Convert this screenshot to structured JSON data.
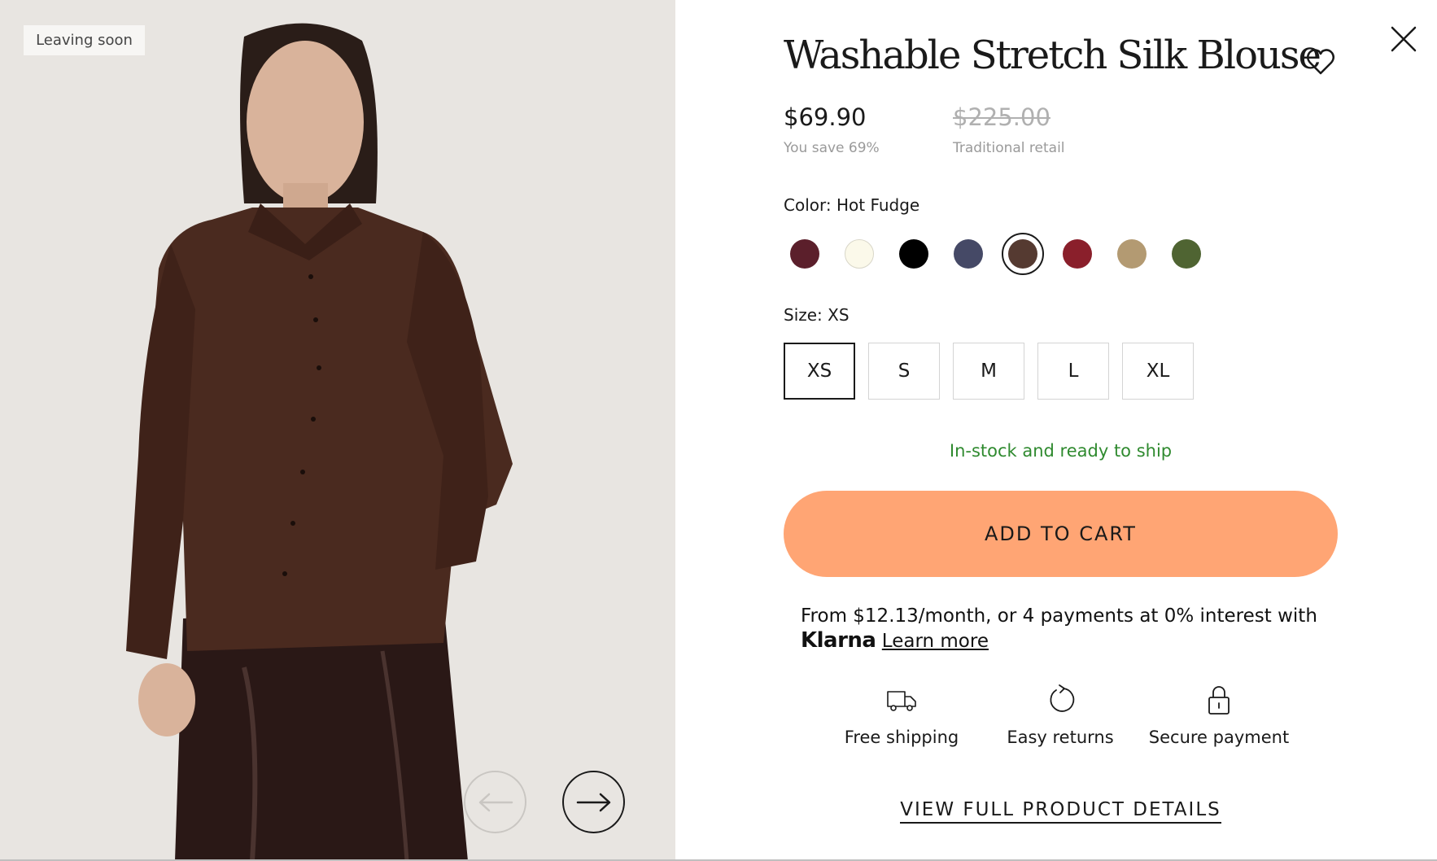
{
  "gallery": {
    "badge": "Leaving soon",
    "prev_icon": "arrow-left-icon",
    "next_icon": "arrow-right-icon"
  },
  "product": {
    "title": "Washable Stretch Silk Blouse",
    "price": "$69.90",
    "savings": "You save 69%",
    "original_price": "$225.00",
    "original_label": "Traditional retail",
    "color_label": "Color:",
    "color_value": "Hot Fudge",
    "colors": [
      {
        "hex": "#5b1f2b"
      },
      {
        "hex": "#fbf9ea"
      },
      {
        "hex": "#000000"
      },
      {
        "hex": "#454966"
      },
      {
        "hex": "#553a31",
        "selected": true
      },
      {
        "hex": "#8a1f2b"
      },
      {
        "hex": "#b39a72"
      },
      {
        "hex": "#4f6432"
      }
    ],
    "size_label": "Size:",
    "size_value": "XS",
    "sizes": [
      "XS",
      "S",
      "M",
      "L",
      "XL"
    ],
    "selected_size": "XS",
    "stock_status": "In-stock and ready to ship",
    "add_to_cart": "ADD TO CART"
  },
  "klarna": {
    "text": "From $12.13/month, or 4 payments at 0% interest with",
    "logo": "Klarna",
    "learn_more": "Learn more"
  },
  "features": [
    {
      "icon": "truck-icon",
      "label": "Free shipping"
    },
    {
      "icon": "return-arrow-icon",
      "label": "Easy returns"
    },
    {
      "icon": "lock-icon",
      "label": "Secure payment"
    }
  ],
  "view_details": "VIEW FULL PRODUCT DETAILS",
  "icons": {
    "close": "close-icon",
    "favorite": "heart-icon"
  },
  "colors": {
    "accent": "#ffa574",
    "stock": "#2f8a2f",
    "muted": "#9a9a9a",
    "panel_bg": "#e8e5e1"
  }
}
